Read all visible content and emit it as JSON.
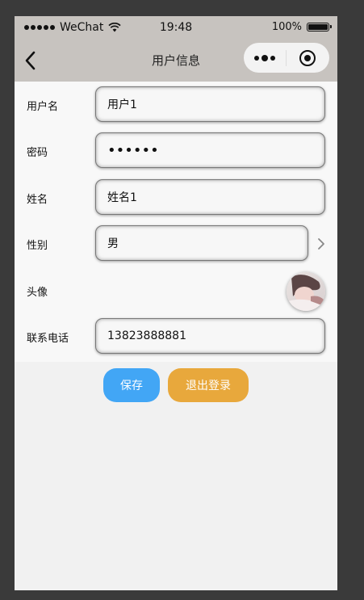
{
  "status_bar": {
    "carrier": "WeChat",
    "time": "19:48",
    "battery": "100%",
    "icons": [
      "signal-dots-icon",
      "wifi-icon",
      "battery-icon"
    ]
  },
  "nav": {
    "title": "用户信息",
    "back_icon": "back-chevron-icon",
    "capsule_icons": [
      "more-dots-icon",
      "close-target-icon"
    ]
  },
  "form": {
    "username": {
      "label": "用户名",
      "value": "用户1"
    },
    "password": {
      "label": "密码",
      "value": "••••••"
    },
    "name": {
      "label": "姓名",
      "value": "姓名1"
    },
    "gender": {
      "label": "性别",
      "value": "男"
    },
    "avatar": {
      "label": "头像"
    },
    "phone": {
      "label": "联系电话",
      "value": "13823888881"
    }
  },
  "buttons": {
    "save": "保存",
    "logout": "退出登录"
  },
  "colors": {
    "header_bg": "#c7c3bf",
    "save_button": "#42a6f5",
    "logout_button": "#e8a83c",
    "form_bg": "#f8f8f8",
    "page_bg": "#f1f1f1"
  }
}
